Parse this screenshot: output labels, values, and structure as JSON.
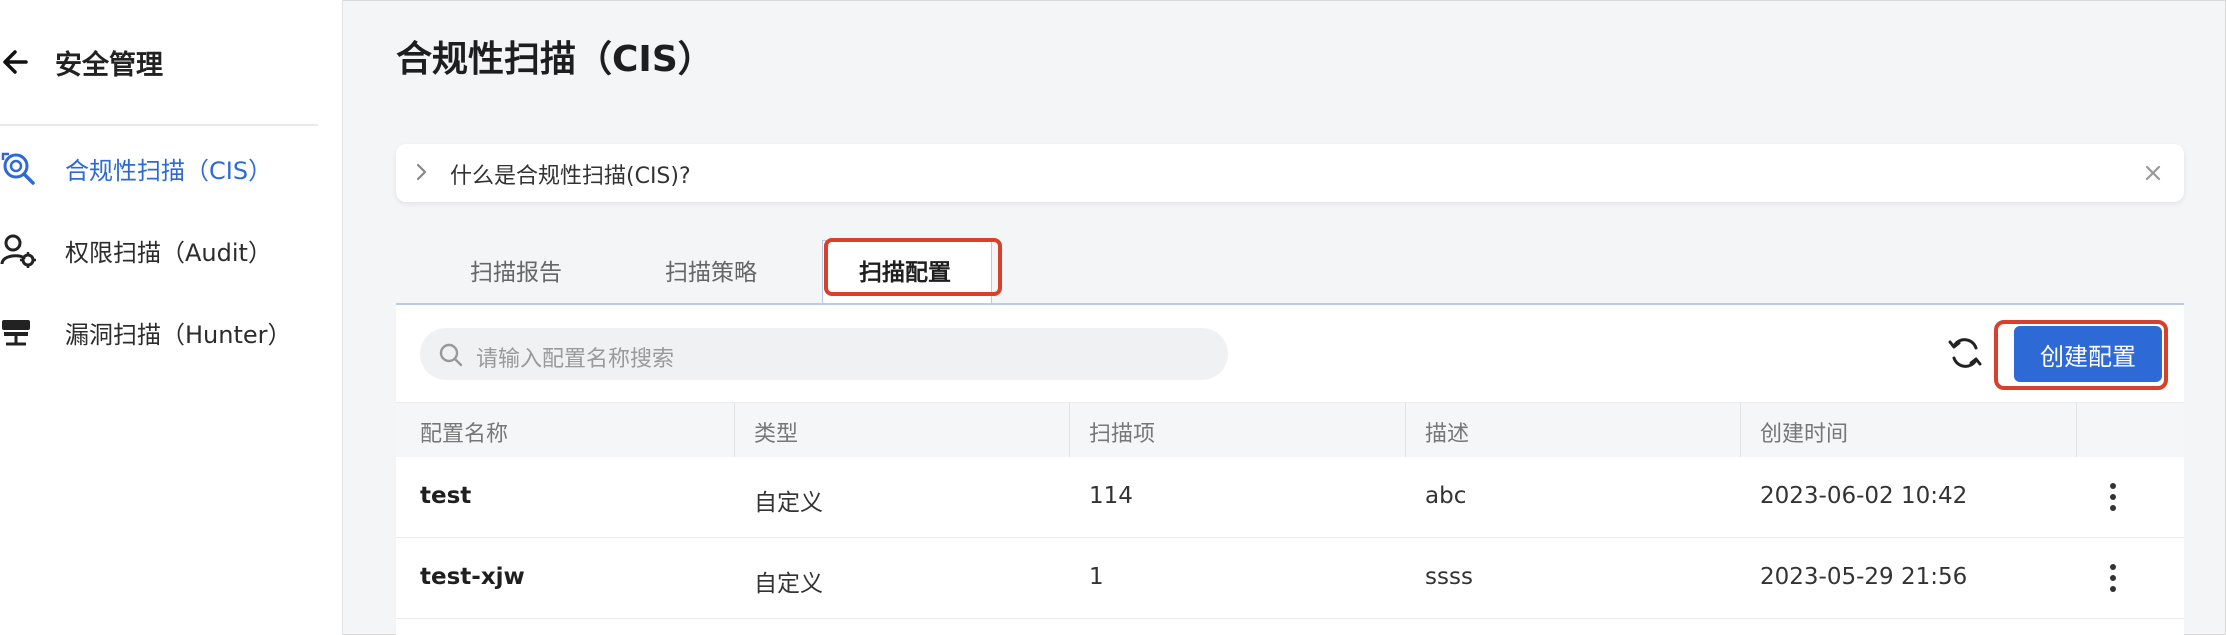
{
  "sidebar": {
    "title": "安全管理",
    "items": [
      {
        "label": "合规性扫描（CIS）",
        "icon": "scan-magnifier-icon",
        "active": true
      },
      {
        "label": "权限扫描（Audit）",
        "icon": "user-gear-icon",
        "active": false
      },
      {
        "label": "漏洞扫描（Hunter）",
        "icon": "server-stack-icon",
        "active": false
      }
    ]
  },
  "page": {
    "title": "合规性扫描（CIS）",
    "help_text": "什么是合规性扫描(CIS)?"
  },
  "tabs": [
    {
      "label": "扫描报告",
      "active": false
    },
    {
      "label": "扫描策略",
      "active": false
    },
    {
      "label": "扫描配置",
      "active": true
    }
  ],
  "toolbar": {
    "search_placeholder": "请输入配置名称搜索",
    "create_label": "创建配置"
  },
  "table": {
    "columns": [
      "配置名称",
      "类型",
      "扫描项",
      "描述",
      "创建时间"
    ],
    "rows": [
      {
        "name": "test",
        "type": "自定义",
        "items": "114",
        "desc": "abc",
        "created": "2023-06-02 10:42"
      },
      {
        "name": "test-xjw",
        "type": "自定义",
        "items": "1",
        "desc": "ssss",
        "created": "2023-05-29 21:56"
      }
    ]
  },
  "colors": {
    "accent": "#2e6ad6",
    "highlight": "#d9402b",
    "background": "#f4f5f7"
  }
}
